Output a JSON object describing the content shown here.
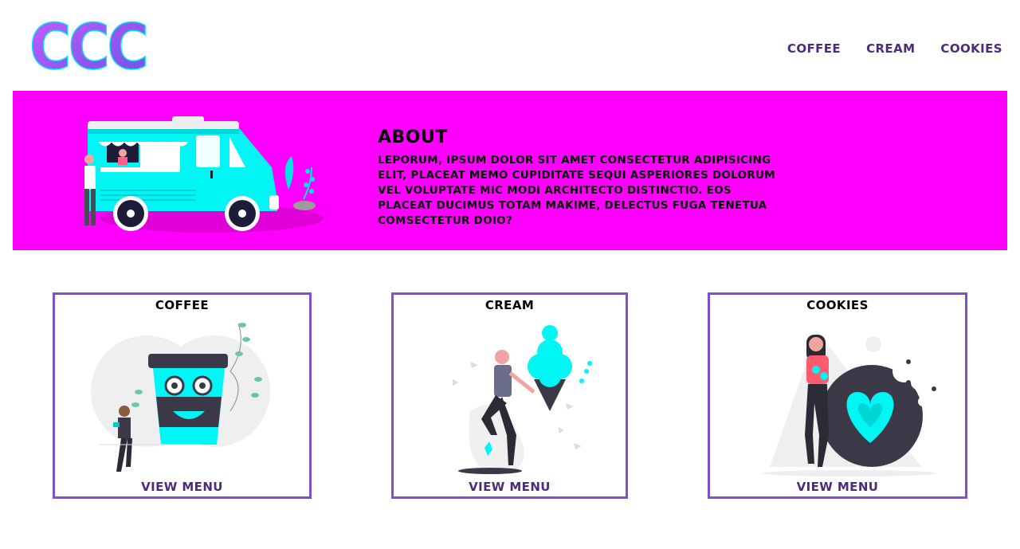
{
  "header": {
    "logo_text": "CCC",
    "nav": [
      {
        "label": "COFFEE"
      },
      {
        "label": "CREAM"
      },
      {
        "label": "COOKIES"
      }
    ]
  },
  "about": {
    "title": "ABOUT",
    "text": "LEPORUM, IPSUM DOLOR SIT AMET CONSECTETUR ADIPISICING ELIT, PLACEAT MEMO CUPIDITATE SEQUI ASPERIORES DOLORUM VEL VOLUPTATE MIC MODI ARCHITECTO DISTINCTIO. EOS PLACEAT DUCIMUS TOTAM MAKIME, DELECTUS FUGA TENETUA COMSECTETUR DOIO?"
  },
  "cards": [
    {
      "title": "COFFEE",
      "link": "VIEW MENU"
    },
    {
      "title": "CREAM",
      "link": "VIEW MENU"
    },
    {
      "title": "COOKIES",
      "link": "VIEW MENU"
    }
  ],
  "colors": {
    "banner": "#ff00ff",
    "accent_cyan": "#00f5f5",
    "nav_purple": "#4d2a7a",
    "card_border": "#7e4fcf",
    "logo_gradient": [
      "#c65bff",
      "#6a55e0"
    ]
  }
}
